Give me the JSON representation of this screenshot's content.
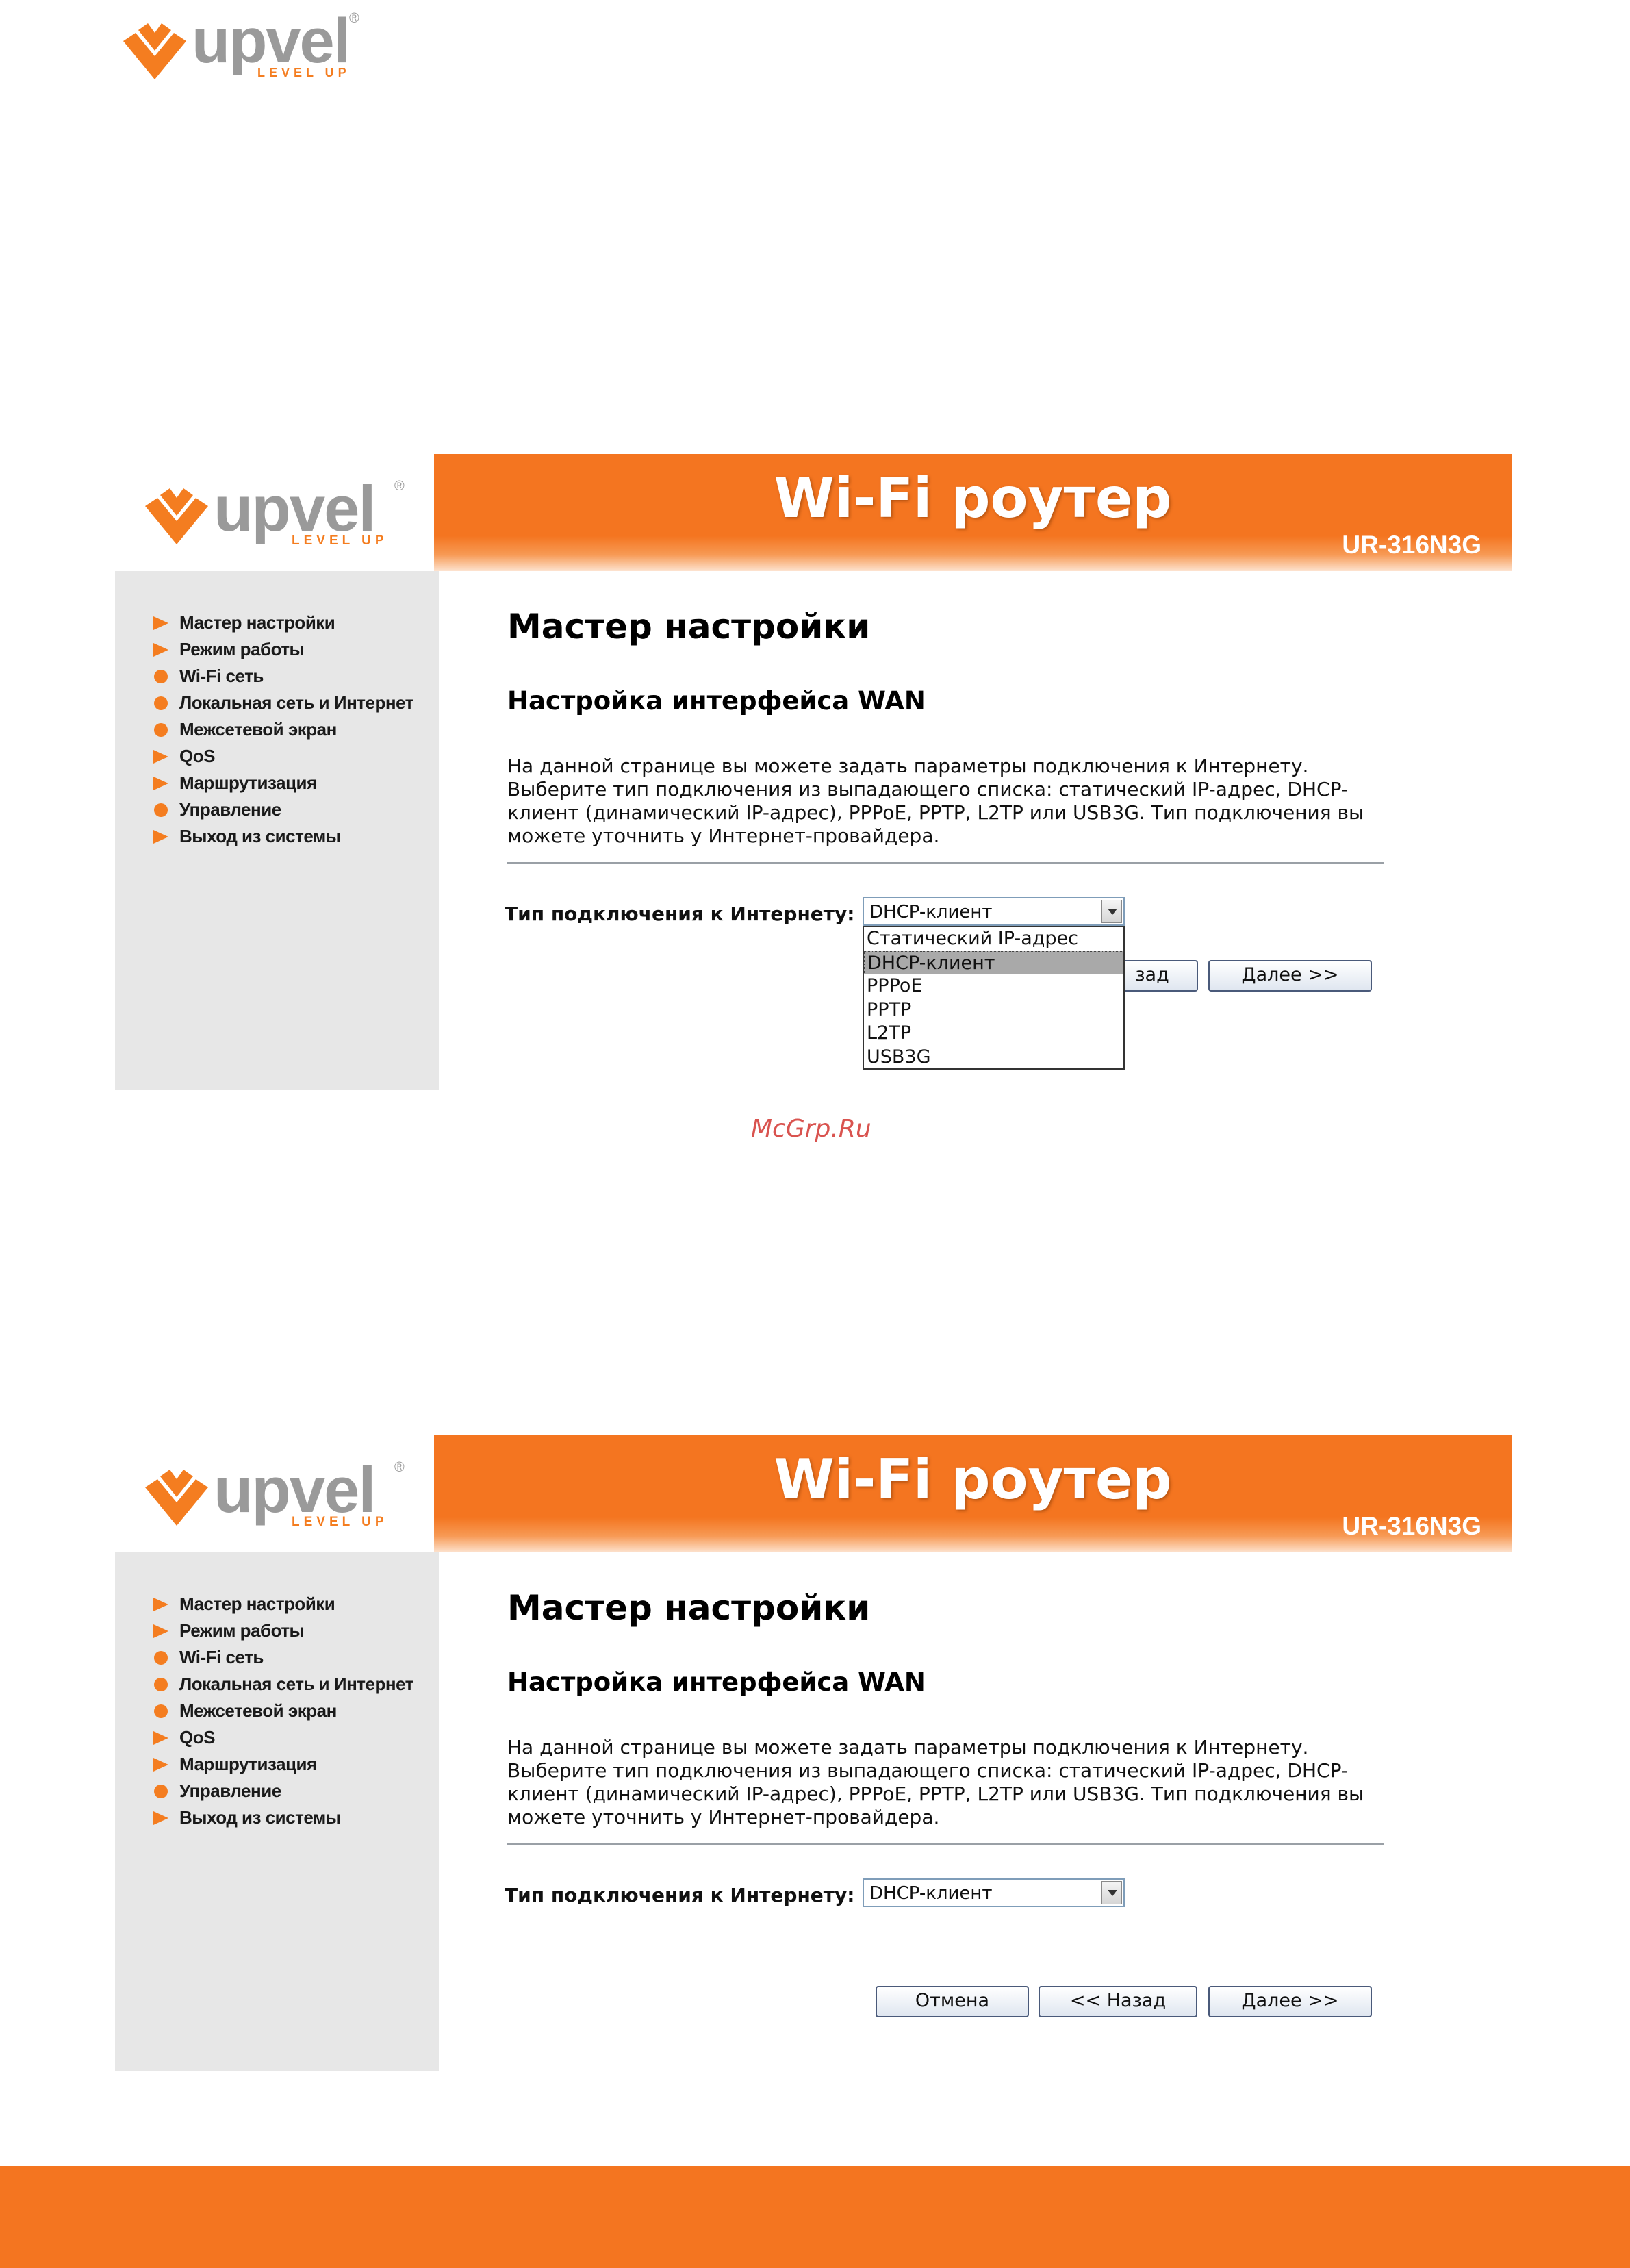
{
  "brand": {
    "word": "upvel",
    "tagline": "LEVEL UP",
    "reg": "®",
    "orange": "#f47d20",
    "gray": "#9a9a9a"
  },
  "watermark": "McGrp.Ru",
  "screens": [
    {
      "banner_title": "Wi-Fi роутер",
      "banner_model": "UR-316N3G",
      "menu": [
        {
          "label": "Мастер настройки",
          "bullet": "triangle"
        },
        {
          "label": "Режим работы",
          "bullet": "triangle"
        },
        {
          "label": "Wi-Fi сеть",
          "bullet": "dot"
        },
        {
          "label": "Локальная сеть и Интернет",
          "bullet": "dot"
        },
        {
          "label": "Межсетевой экран",
          "bullet": "dot"
        },
        {
          "label": "QoS",
          "bullet": "triangle"
        },
        {
          "label": "Маршрутизация",
          "bullet": "triangle"
        },
        {
          "label": "Управление",
          "bullet": "dot"
        },
        {
          "label": "Выход из системы",
          "bullet": "triangle"
        }
      ],
      "title": "Мастер настройки",
      "subtitle": "Настройка интерфейса WAN",
      "desc": [
        "На данной странице вы можете задать параметры подключения к Интернету.",
        "Выберите тип подключения из выпадающего списка: статический IP-адрес, DHCP-",
        "клиент (динамический IP-адрес), PPPoE, PPTP, L2TP или USB3G. Тип подключения вы",
        "можете уточнить у Интернет-провайдера."
      ],
      "field_label": "Тип подключения к Интернету:",
      "select_value": "DHCP-клиент",
      "dropdown_open": true,
      "options": [
        "Статический IP-адрес",
        "DHCP-клиент",
        "PPPoE",
        "PPTP",
        "L2TP",
        "USB3G"
      ],
      "selected_index": 1,
      "buttons": {
        "back_partial": "зад",
        "next": "Далее >>"
      }
    },
    {
      "banner_title": "Wi-Fi роутер",
      "banner_model": "UR-316N3G",
      "menu": [
        {
          "label": "Мастер настройки",
          "bullet": "triangle"
        },
        {
          "label": "Режим работы",
          "bullet": "triangle"
        },
        {
          "label": "Wi-Fi сеть",
          "bullet": "dot"
        },
        {
          "label": "Локальная сеть и Интернет",
          "bullet": "dot"
        },
        {
          "label": "Межсетевой экран",
          "bullet": "dot"
        },
        {
          "label": "QoS",
          "bullet": "triangle"
        },
        {
          "label": "Маршрутизация",
          "bullet": "triangle"
        },
        {
          "label": "Управление",
          "bullet": "dot"
        },
        {
          "label": "Выход из системы",
          "bullet": "triangle"
        }
      ],
      "title": "Мастер настройки",
      "subtitle": "Настройка интерфейса WAN",
      "desc": [
        "На данной странице вы можете задать параметры подключения к Интернету.",
        "Выберите тип подключения из выпадающего списка: статический IP-адрес, DHCP-",
        "клиент (динамический IP-адрес), PPPoE, PPTP, L2TP или USB3G. Тип подключения вы",
        "можете уточнить у Интернет-провайдера."
      ],
      "field_label": "Тип подключения к Интернету:",
      "select_value": "DHCP-клиент",
      "dropdown_open": false,
      "buttons": {
        "cancel": "Отмена",
        "back": "<< Назад",
        "next": "Далее >>"
      }
    }
  ]
}
